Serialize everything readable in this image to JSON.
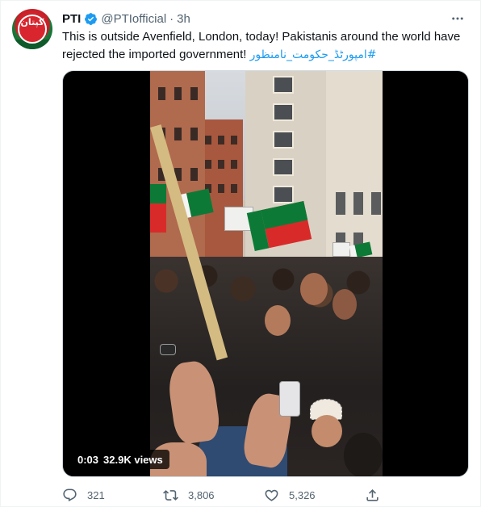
{
  "tweet": {
    "author_name": "PTI",
    "handle": "@PTIofficial",
    "separator": "·",
    "time": "3h",
    "text": "This is outside Avenfield, London, today! Pakistanis around the world have rejected the imported government!",
    "hashtag": "#امپورٹڈ_حکومت_نامنظور",
    "avatar_text": "کپتان"
  },
  "video": {
    "duration": "0:03",
    "views": "32.9K views"
  },
  "actions": {
    "replies": "321",
    "retweets": "3,806",
    "likes": "5,326"
  },
  "icons": [
    "verified-badge-icon",
    "more-options-icon",
    "reply-icon",
    "retweet-icon",
    "like-icon",
    "share-icon"
  ],
  "colors": {
    "link": "#1d9bf0",
    "secondary_text": "#536471",
    "verified": "#1d9bf0"
  }
}
